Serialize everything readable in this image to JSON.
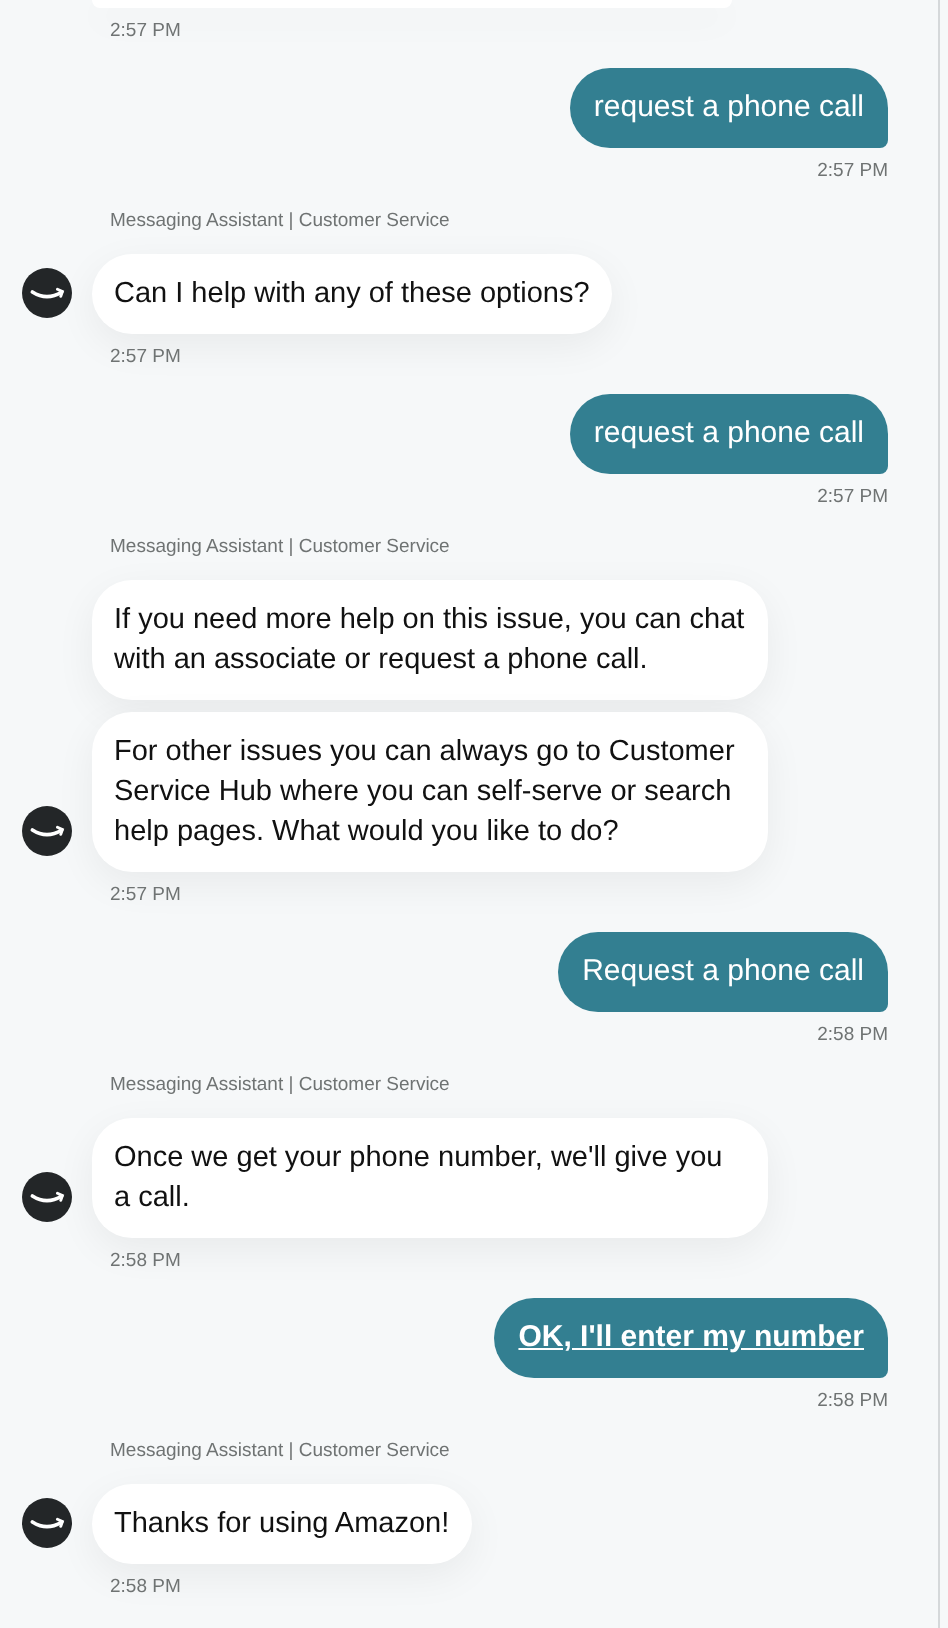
{
  "messages": [
    {
      "kind": "bot",
      "partial": true,
      "time": "2:57 PM"
    },
    {
      "kind": "user",
      "link": false,
      "text": "request a phone call",
      "time": "2:57 PM"
    },
    {
      "kind": "bot",
      "sender": "Messaging Assistant | Customer Service",
      "bubbles": [
        "Can I help with any of these options?"
      ],
      "time": "2:57 PM"
    },
    {
      "kind": "user",
      "link": false,
      "text": "request a phone call",
      "time": "2:57 PM"
    },
    {
      "kind": "bot",
      "sender": "Messaging Assistant | Customer Service",
      "bubbles": [
        "If you need more help on this issue, you can chat with an associate or request a phone call.",
        "For other issues you can always go to Customer Service Hub where you can self-serve or search help pages. What would you like to do?"
      ],
      "time": "2:57 PM"
    },
    {
      "kind": "user",
      "link": false,
      "text": "Request a phone call",
      "time": "2:58 PM"
    },
    {
      "kind": "bot",
      "sender": "Messaging Assistant | Customer Service",
      "bubbles": [
        "Once we get your phone number, we'll give you a call."
      ],
      "time": "2:58 PM"
    },
    {
      "kind": "user",
      "link": true,
      "text": "OK, I'll enter my number",
      "time": "2:58 PM"
    },
    {
      "kind": "bot",
      "sender": "Messaging Assistant | Customer Service",
      "bubbles": [
        "Thanks for using Amazon!"
      ],
      "time": "2:58 PM"
    }
  ]
}
